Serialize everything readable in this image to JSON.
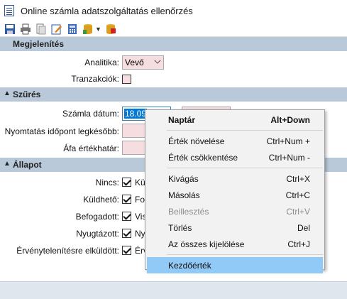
{
  "window": {
    "title": "Online számla adatszolgáltatás ellenőrzés"
  },
  "toolbar": {
    "icons": [
      "save-icon",
      "print-icon",
      "print-preview-icon",
      "edit-icon",
      "calculator-icon",
      "database-icon",
      "dropdown-arrow-icon",
      "clear-database-icon"
    ]
  },
  "sections": {
    "megjelenites": {
      "title": "Megjelenítés",
      "analitika_label": "Analitika:",
      "analitika_value": "Vevő",
      "tranzakciok_label": "Tranzakciók:"
    },
    "szures": {
      "title": "Szűrés",
      "szamla_datum_label": "Számla dátum:",
      "szamla_datum_value": "18.09",
      "nyomtatas_label": "Nyomtatás időpont legkésőbb:",
      "afa_label": "Áfa értékhatár:"
    },
    "allapot": {
      "title": "Állapot",
      "rows": [
        {
          "label": "Nincs:",
          "text": "Kü",
          "checked": true
        },
        {
          "label": "Küldhető:",
          "text": "Fo",
          "checked": true
        },
        {
          "label": "Befogadott:",
          "text": "Vis",
          "checked": true
        },
        {
          "label": "Nyugtázott:",
          "text": "Ny",
          "checked": true
        },
        {
          "label": "Érvénytelenítésre elküldött:",
          "text": "Érv",
          "checked": true
        }
      ]
    }
  },
  "context_menu": {
    "items": [
      {
        "label": "Naptár",
        "shortcut": "Alt+Down",
        "bold": true
      },
      {
        "label": "Érték növelése",
        "shortcut": "Ctrl+Num +"
      },
      {
        "label": "Érték csökkentése",
        "shortcut": "Ctrl+Num -"
      },
      {
        "label": "Kivágás",
        "shortcut": "Ctrl+X"
      },
      {
        "label": "Másolás",
        "shortcut": "Ctrl+C"
      },
      {
        "label": "Beillesztés",
        "shortcut": "Ctrl+V",
        "disabled": true
      },
      {
        "label": "Törlés",
        "shortcut": "Del"
      },
      {
        "label": "Az összes kijelölése",
        "shortcut": "Ctrl+J"
      },
      {
        "label": "Kezdőérték",
        "shortcut": "",
        "highlighted": true
      }
    ]
  },
  "colors": {
    "section_header": "#b9c9da",
    "required_field": "#f5dde0",
    "menu_highlight": "#91c9f7",
    "selection": "#0078d7"
  }
}
